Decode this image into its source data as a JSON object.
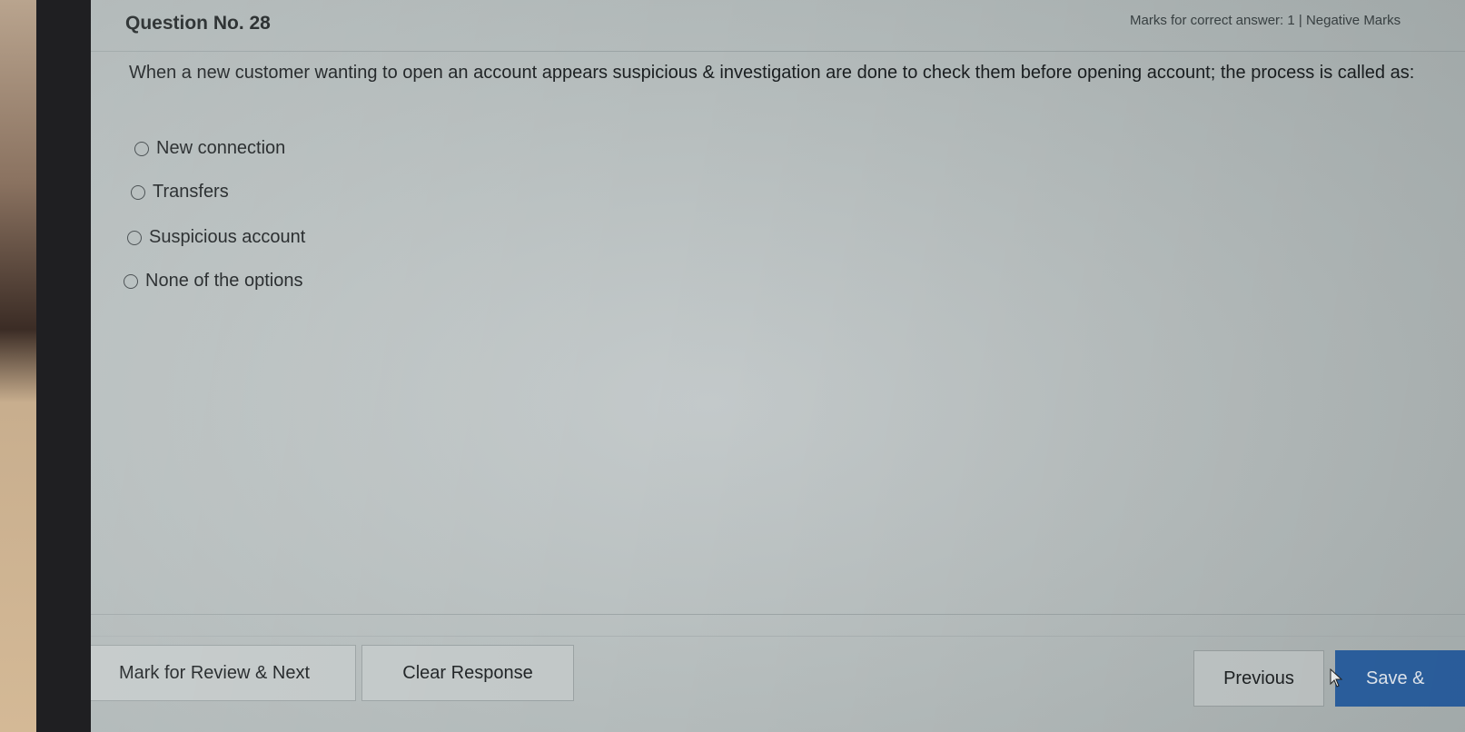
{
  "header": {
    "question_number": "Question No. 28",
    "marks_info": "Marks for correct answer: 1  |  Negative Marks"
  },
  "question": {
    "text": "When a new customer wanting to open an account appears suspicious & investigation are done to check them before opening account; the process is called as:"
  },
  "options": [
    {
      "label": "New connection",
      "selected": false
    },
    {
      "label": "Transfers",
      "selected": false
    },
    {
      "label": "Suspicious account",
      "selected": false
    },
    {
      "label": "None of the options",
      "selected": false
    }
  ],
  "footer": {
    "mark_review_label": "Mark for Review & Next",
    "clear_label": "Clear Response",
    "previous_label": "Previous",
    "save_label": "Save &"
  },
  "colors": {
    "save_button": "#2c62a3",
    "screen_bg": "#bcc2c3"
  },
  "icons": {
    "cursor": "mouse-pointer-icon"
  }
}
